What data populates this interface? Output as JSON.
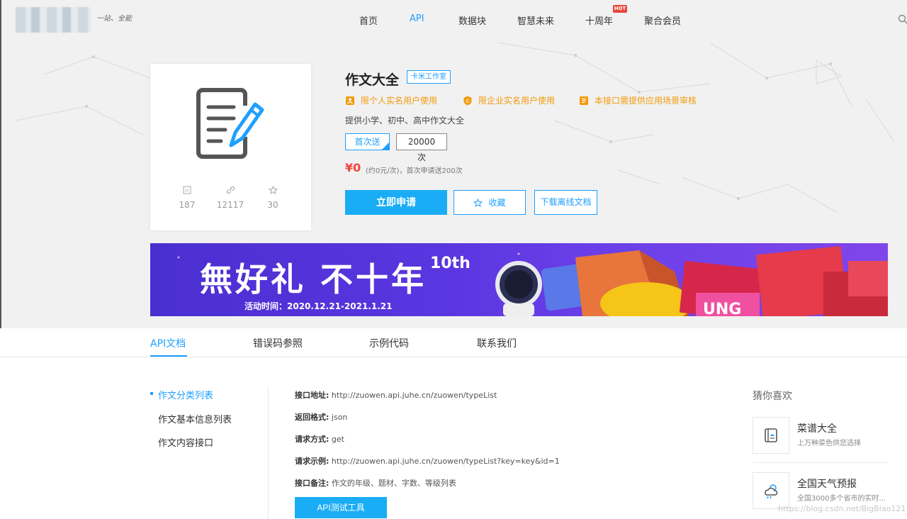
{
  "nav": {
    "slogan": "一站、全能",
    "items": [
      "首页",
      "API",
      "数据块",
      "智慧未来",
      "十周年",
      "聚合会员"
    ],
    "active_index": 1,
    "hot_badge": "HOT"
  },
  "product": {
    "title": "作文大全",
    "studio": "卡米工作室",
    "limits": [
      "限个人实名用户使用",
      "限企业实名用户使用",
      "本接口需提供应用场景审核"
    ],
    "description": "提供小学、初中、高中作文大全",
    "stats": {
      "id": "187",
      "calls": "12117",
      "favorites": "30"
    },
    "plans": {
      "first": "首次送",
      "count": "20000次"
    },
    "price": "¥0",
    "price_note": "(约0元/次)，首次申请送200次",
    "buttons": {
      "apply": "立即申请",
      "favorite": "收藏",
      "download": "下载离线文档"
    }
  },
  "banner": {
    "title": "無好礼 不十年",
    "superscript": "10th",
    "date": "活动时间：2020.12.21-2021.1.21"
  },
  "tabs": [
    "API文档",
    "错误码参照",
    "示例代码",
    "联系我们"
  ],
  "menu": [
    "作文分类列表",
    "作文基本信息列表",
    "作文内容接口"
  ],
  "doc": {
    "fields": [
      {
        "label": "接口地址:",
        "value": "http://zuowen.api.juhe.cn/zuowen/typeList"
      },
      {
        "label": "返回格式:",
        "value": "json"
      },
      {
        "label": "请求方式:",
        "value": "get"
      },
      {
        "label": "请求示例:",
        "value": "http://zuowen.api.juhe.cn/zuowen/typeList?key=key&id=1"
      },
      {
        "label": "接口备注:",
        "value": "作文的年级、题材、字数、等级列表"
      }
    ],
    "test_button": "API测试工具"
  },
  "recommend": {
    "title": "猜你喜欢",
    "items": [
      {
        "name": "菜谱大全",
        "sub": "上万种菜色供您选择"
      },
      {
        "name": "全国天气预报",
        "sub": "全国3000多个省市的实时..."
      }
    ]
  },
  "watermark": "https://blog.csdn.net/BigBiao121",
  "colors": {
    "accent": "#1e9fff",
    "warning": "#f29b0a",
    "price": "#f0443a",
    "apply": "#1aadf5"
  }
}
